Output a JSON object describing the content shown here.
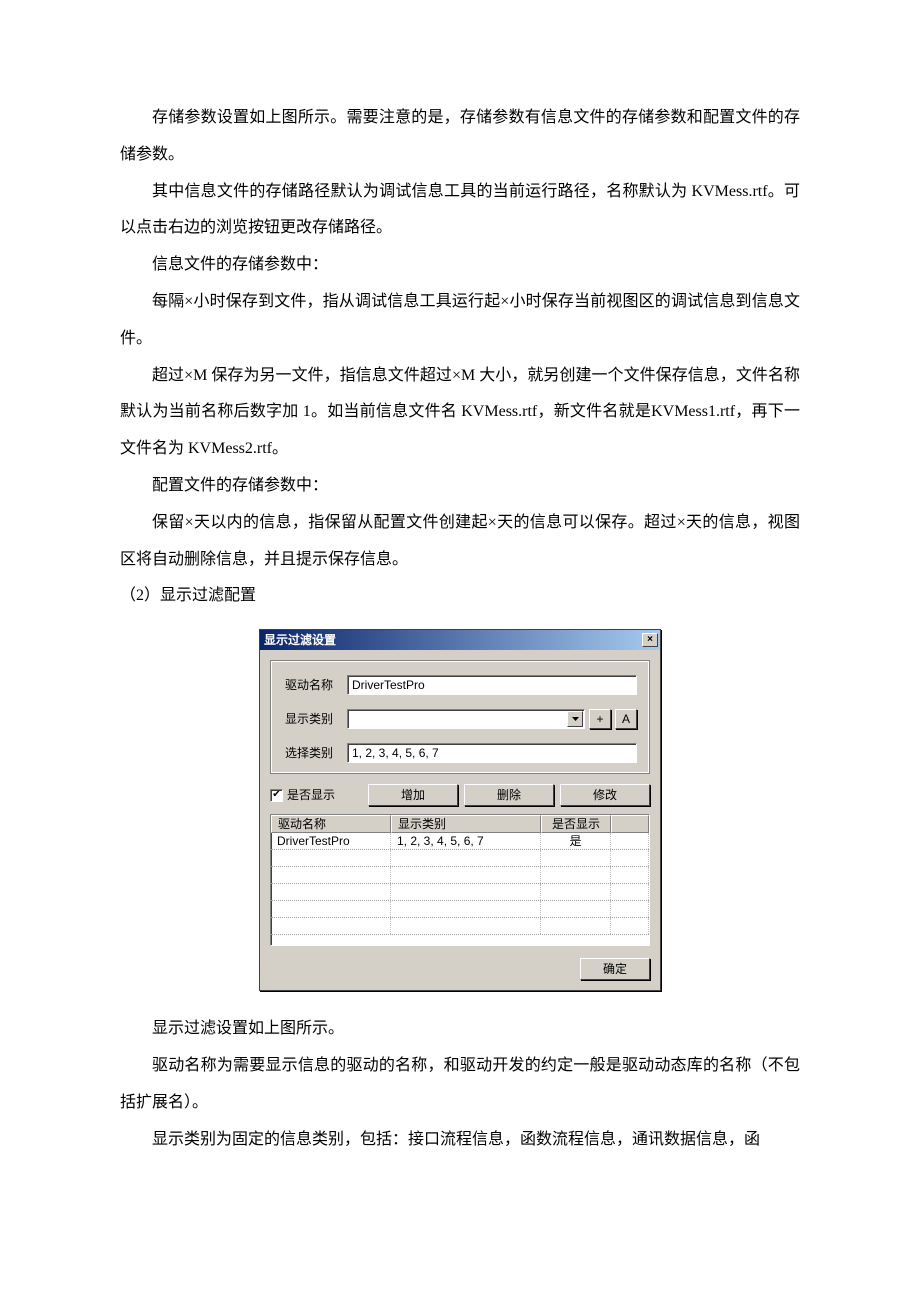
{
  "paragraphs": {
    "p1": "存储参数设置如上图所示。需要注意的是，存储参数有信息文件的存储参数和配置文件的存储参数。",
    "p2": "其中信息文件的存储路径默认为调试信息工具的当前运行路径，名称默认为 KVMess.rtf。可以点击右边的浏览按钮更改存储路径。",
    "p3": "信息文件的存储参数中：",
    "p4": "每隔×小时保存到文件，指从调试信息工具运行起×小时保存当前视图区的调试信息到信息文件。",
    "p5": "超过×M 保存为另一文件，指信息文件超过×M 大小，就另创建一个文件保存信息，文件名称默认为当前名称后数字加 1。如当前信息文件名 KVMess.rtf，新文件名就是KVMess1.rtf，再下一文件名为 KVMess2.rtf。",
    "p6": "配置文件的存储参数中：",
    "p7": "保留×天以内的信息，指保留从配置文件创建起×天的信息可以保存。超过×天的信息，视图区将自动删除信息，并且提示保存信息。",
    "p8": "（2）显示过滤配置",
    "p9": "显示过滤设置如上图所示。",
    "p10": "驱动名称为需要显示信息的驱动的名称，和驱动开发的约定一般是驱动动态库的名称（不包括扩展名）。",
    "p11": "显示类别为固定的信息类别，包括：接口流程信息，函数流程信息，通讯数据信息，函"
  },
  "dialog": {
    "title": "显示过滤设置",
    "close": "×",
    "labels": {
      "driver_name": "驱动名称",
      "display_type": "显示类别",
      "select_type": "选择类别"
    },
    "fields": {
      "driver_name_value": "DriverTestPro",
      "display_type_value": "",
      "select_type_value": "1, 2, 3, 4, 5, 6, 7"
    },
    "small_buttons": {
      "plus": "+",
      "a": "A"
    },
    "checkbox_label": "是否显示",
    "checkbox_checked": "✔",
    "buttons": {
      "add": "增加",
      "delete": "删除",
      "modify": "修改",
      "ok": "确定"
    },
    "columns": {
      "c1": "驱动名称",
      "c2": "显示类别",
      "c3": "是否显示"
    },
    "row0": {
      "c1": "DriverTestPro",
      "c2": "1, 2, 3, 4, 5, 6, 7",
      "c3": "是"
    }
  }
}
